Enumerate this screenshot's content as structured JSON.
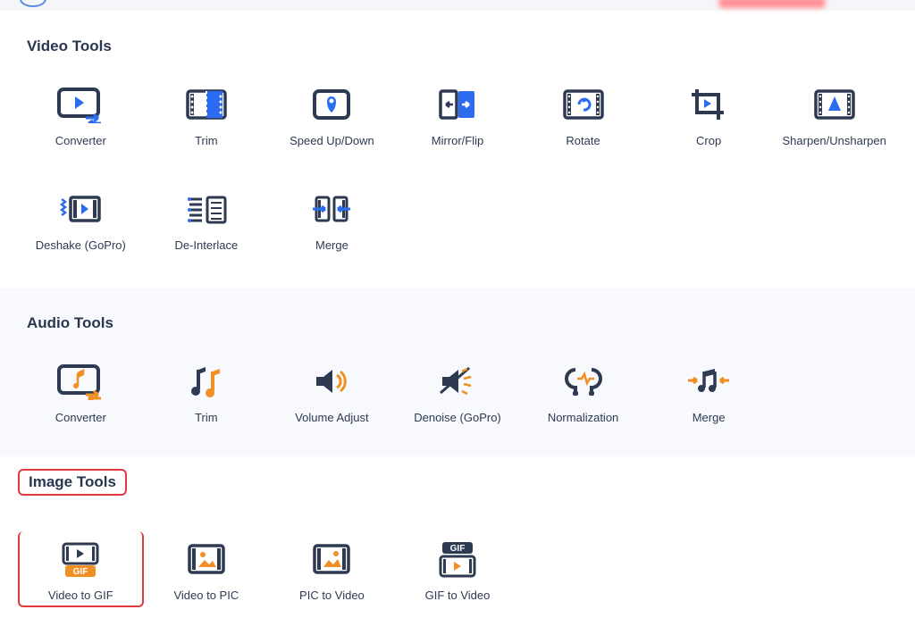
{
  "colors": {
    "frame": "#2d3a52",
    "accentBlue": "#2c6cf0",
    "accentOrange": "#f08f24"
  },
  "sections": {
    "video": {
      "title": "Video Tools",
      "tools": [
        {
          "label": "Converter"
        },
        {
          "label": "Trim"
        },
        {
          "label": "Speed Up/Down"
        },
        {
          "label": "Mirror/Flip"
        },
        {
          "label": "Rotate"
        },
        {
          "label": "Crop"
        },
        {
          "label": "Sharpen/Unsharpen"
        },
        {
          "label": "Deshake (GoPro)"
        },
        {
          "label": "De-Interlace"
        },
        {
          "label": "Merge"
        }
      ]
    },
    "audio": {
      "title": "Audio Tools",
      "tools": [
        {
          "label": "Converter"
        },
        {
          "label": "Trim"
        },
        {
          "label": "Volume Adjust"
        },
        {
          "label": "Denoise (GoPro)"
        },
        {
          "label": "Normalization"
        },
        {
          "label": "Merge"
        }
      ]
    },
    "image": {
      "title": "Image Tools",
      "tools": [
        {
          "label": "Video to GIF"
        },
        {
          "label": "Video to PIC"
        },
        {
          "label": "PIC to Video"
        },
        {
          "label": "GIF to Video"
        }
      ]
    }
  }
}
